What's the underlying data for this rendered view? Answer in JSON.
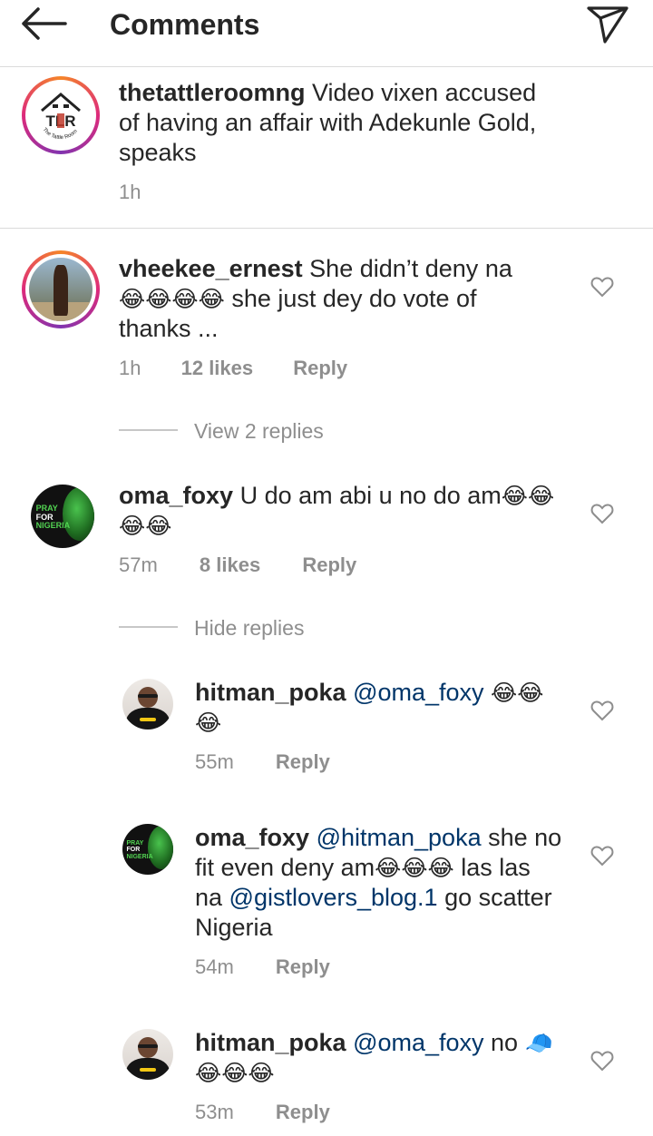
{
  "header": {
    "title": "Comments",
    "back_icon": "arrow-left-icon",
    "send_icon": "paper-plane-icon"
  },
  "caption": {
    "username": "thetattleroomng",
    "line1": "Video vixen accused",
    "line2": "of having an affair with Adekunle Gold,",
    "line3": "speaks",
    "time": "1h",
    "avatar_initials": "TLR",
    "avatar_ring_text": "The Tattle Room"
  },
  "comments": [
    {
      "username": "vheekee_ernest",
      "line1": "She didn’t deny na",
      "line2_emoji": "😂😂😂😂",
      "line2_text": " she just dey do vote of",
      "line3": "thanks ...",
      "time": "1h",
      "likes": "12 likes",
      "reply": "Reply",
      "view_replies": "View 2 replies"
    },
    {
      "username": "oma_foxy",
      "line1_text": "U do am abi u no do am",
      "line1_emoji": "😂😂",
      "line2_emoji": "😂😂",
      "time": "57m",
      "likes": "8 likes",
      "reply": "Reply",
      "hide_replies": "Hide replies",
      "avatar_text1": "PRAY",
      "avatar_text2": "FOR",
      "avatar_text3": "NIGERIA"
    }
  ],
  "replies": [
    {
      "username": "hitman_poka",
      "mention": "@oma_foxy",
      "line1_emoji": "😂😂",
      "line2_emoji": "😂",
      "time": "55m",
      "reply": "Reply"
    },
    {
      "username": "oma_foxy",
      "mention": "@hitman_poka",
      "line1_text": " she no",
      "line2_text": "fit even deny am",
      "line2_emoji": "😂😂😂",
      "line2_tail": " las las",
      "line3_pre": "na ",
      "line3_mention": "@gistlovers_blog.1",
      "line3_tail": " go scatter",
      "line4": "Nigeria",
      "time": "54m",
      "reply": "Reply",
      "avatar_text1": "PRAY",
      "avatar_text2": "FOR",
      "avatar_text3": "NIGERIA"
    },
    {
      "username": "hitman_poka",
      "mention": "@oma_foxy",
      "line1_text": " no ",
      "line1_icon": "🧢",
      "line2_emoji": "😂😂😂",
      "time": "53m",
      "reply": "Reply"
    }
  ],
  "colors": {
    "text": "#262626",
    "muted": "#8e8e8e",
    "mention": "#003569",
    "divider": "#dbdbdb"
  }
}
